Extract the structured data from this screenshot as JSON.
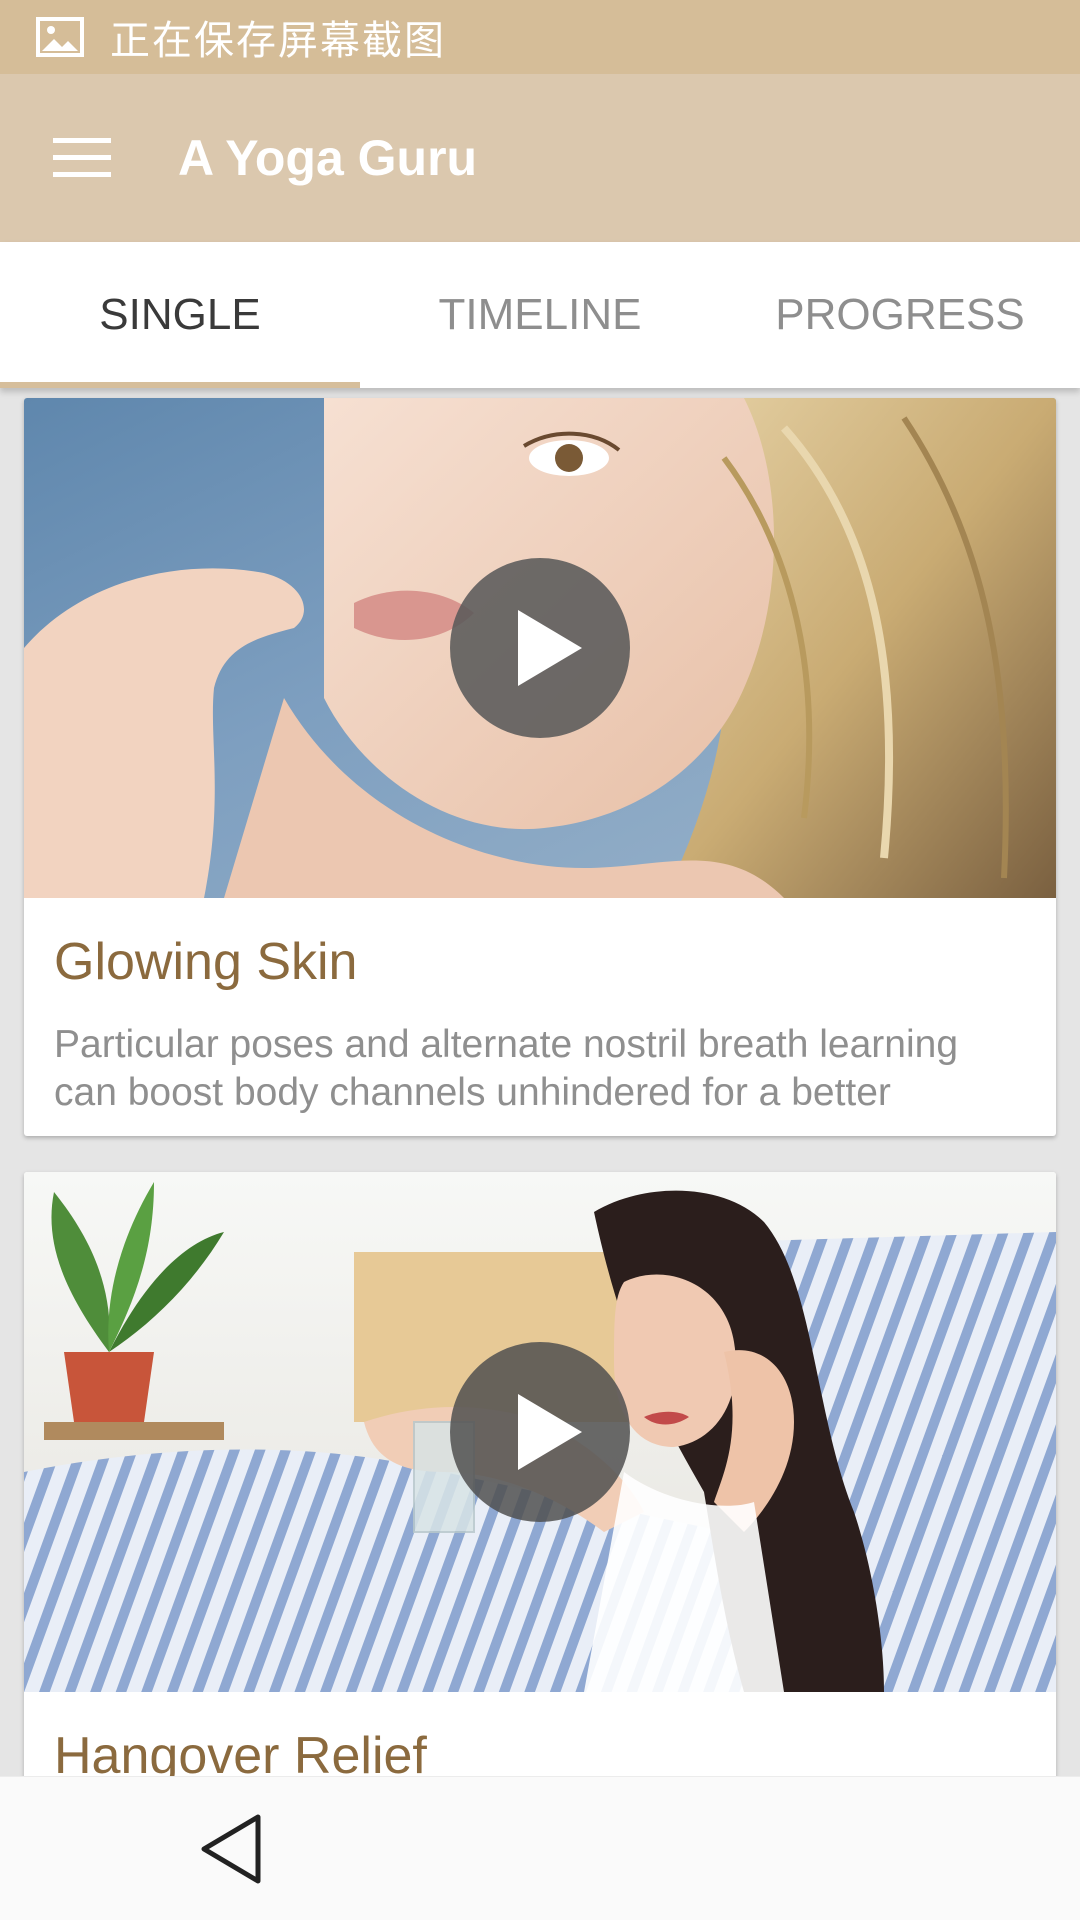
{
  "status_bar": {
    "text": "正在保存屏幕截图",
    "icon": "image-icon"
  },
  "app_bar": {
    "title": "A Yoga Guru",
    "menu_icon": "hamburger-menu-icon"
  },
  "tabs": [
    {
      "label": "SINGLE",
      "active": true
    },
    {
      "label": "TIMELINE",
      "active": false
    },
    {
      "label": "PROGRESS",
      "active": false
    }
  ],
  "cards": [
    {
      "title": "Glowing Skin",
      "description": "Particular poses and alternate nostril breath learning can boost body channels unhindered for a better",
      "play_icon": "play-icon"
    },
    {
      "title": "Hangover Relief",
      "description": "",
      "play_icon": "play-icon"
    }
  ],
  "nav_bar": {
    "back_icon": "back-triangle-icon"
  },
  "colors": {
    "status_bar": "#d5bd98",
    "app_bar": "#dbc8ae",
    "tab_indicator": "#d6be9b",
    "card_title": "#8b6a3e",
    "card_desc": "#8f8f8f"
  }
}
